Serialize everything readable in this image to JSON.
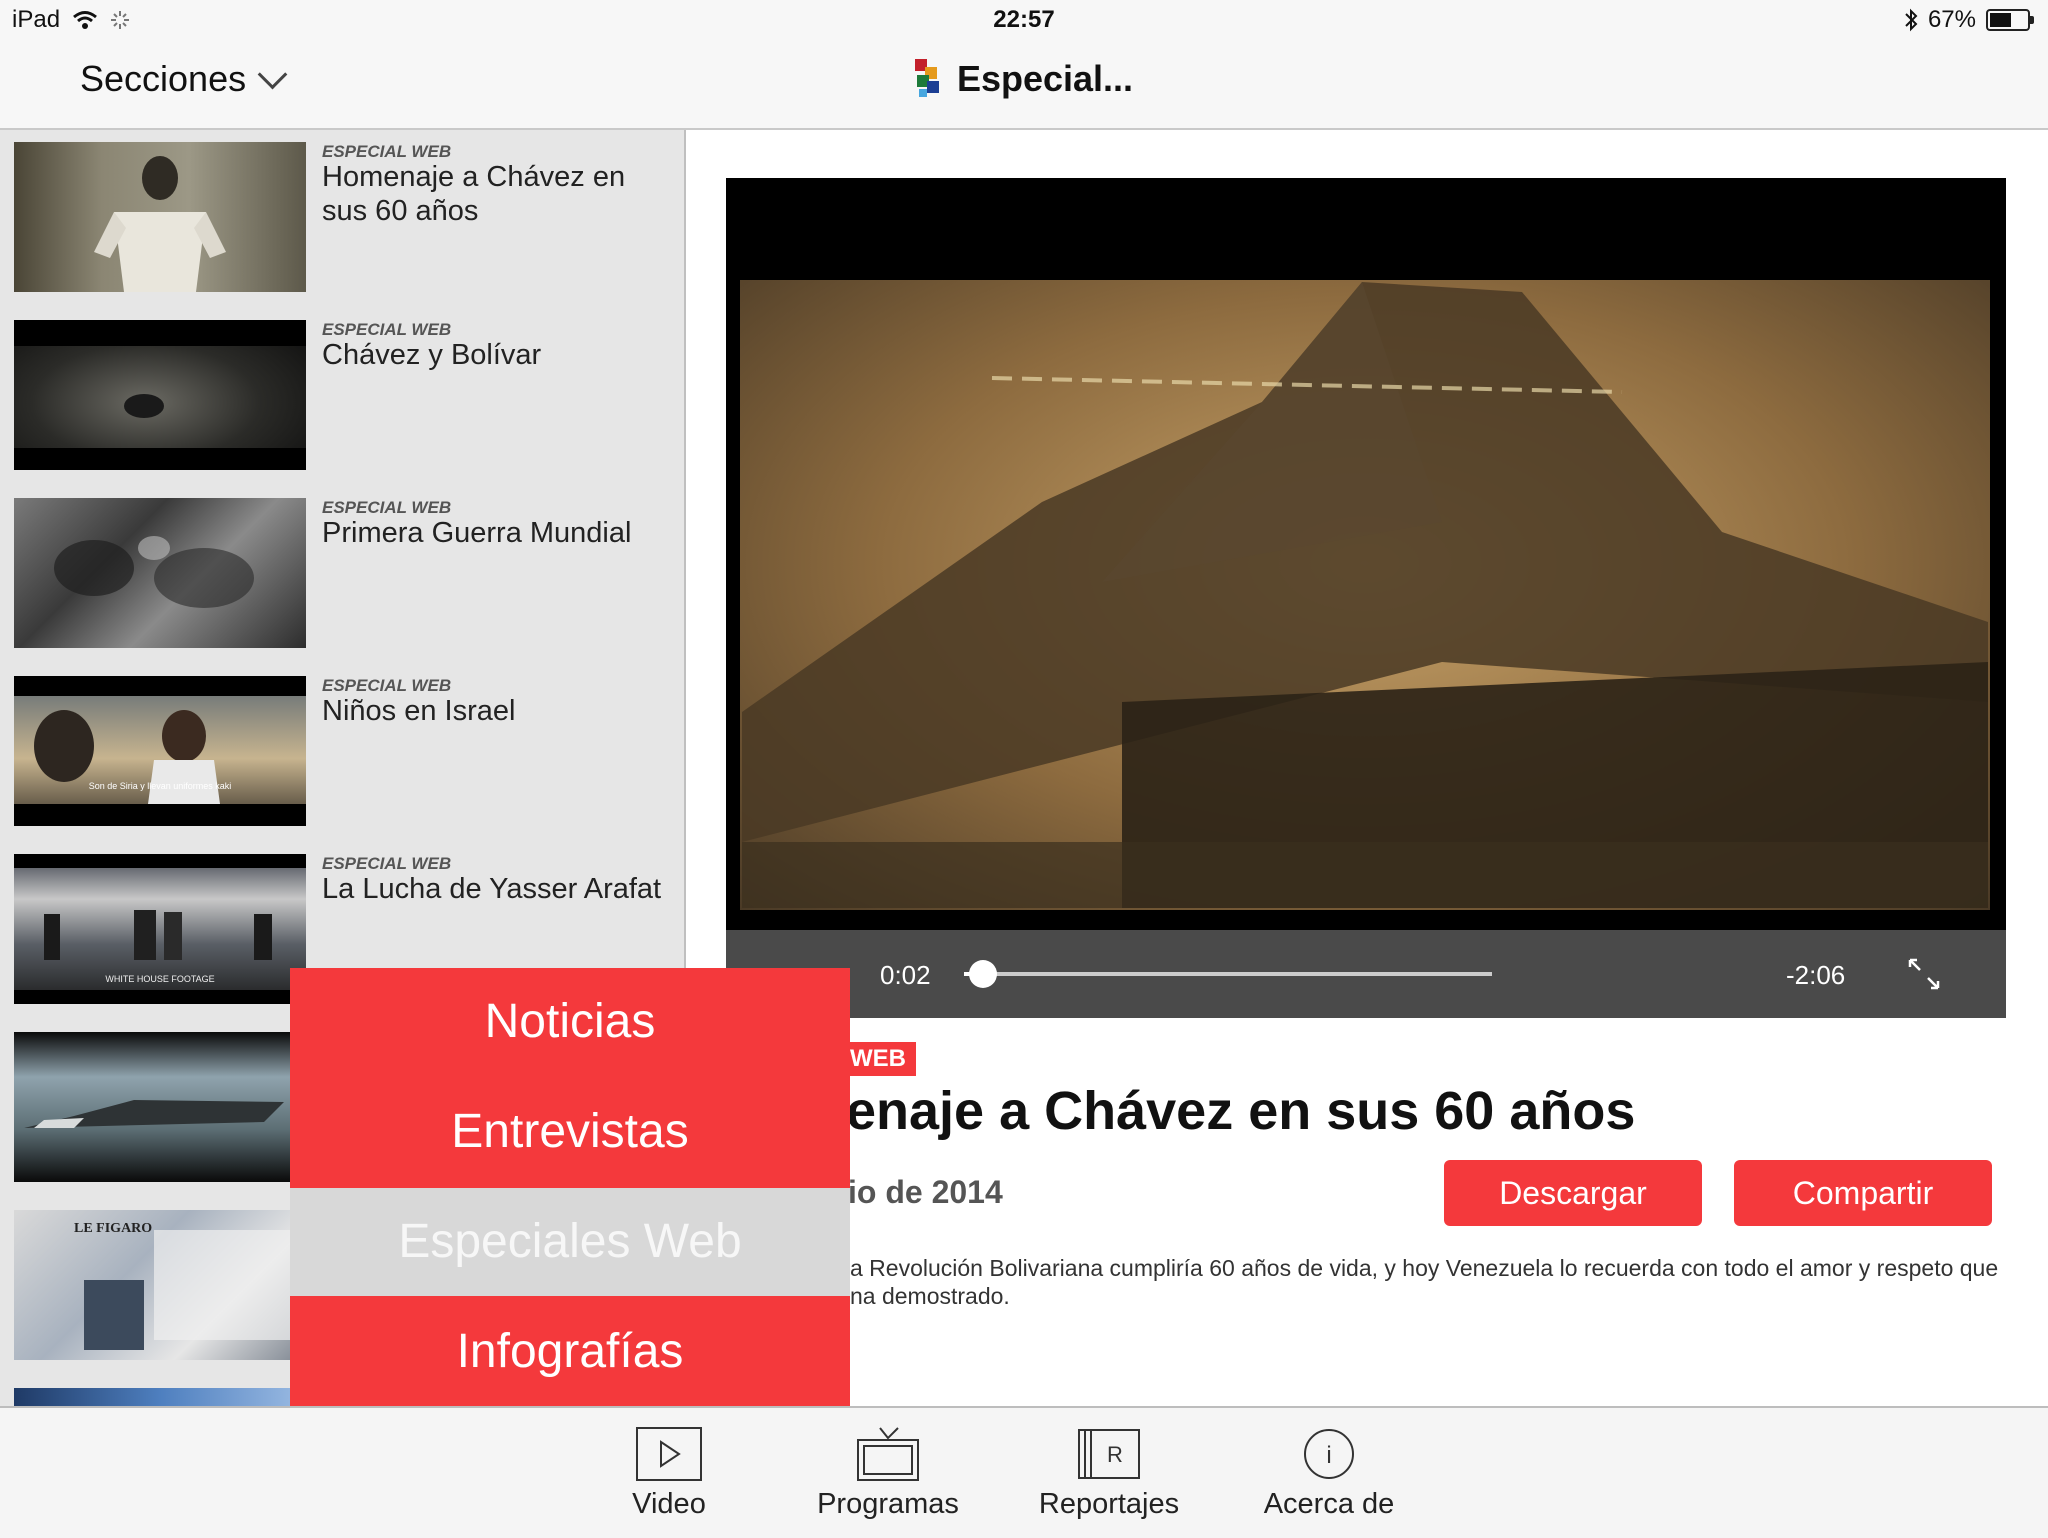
{
  "status": {
    "device": "iPad",
    "time": "22:57",
    "battery": "67%",
    "battery_level": 0.67
  },
  "nav": {
    "sections_label": "Secciones",
    "title": "Especial..."
  },
  "list": [
    {
      "category": "ESPECIAL WEB",
      "title": "Homenaje a Chávez en sus 60 años"
    },
    {
      "category": "ESPECIAL WEB",
      "title": "Chávez y Bolívar"
    },
    {
      "category": "ESPECIAL WEB",
      "title": "Primera Guerra Mundial"
    },
    {
      "category": "ESPECIAL WEB",
      "title": "Niños en Israel",
      "caption": "Son de Siria y llevan uniformes kaki"
    },
    {
      "category": "ESPECIAL WEB",
      "title": "La Lucha de Yasser Arafat",
      "caption": "WHITE HOUSE FOOTAGE"
    },
    {
      "category": "",
      "title": ""
    },
    {
      "category": "",
      "title": "",
      "caption": "LE FIGARO"
    }
  ],
  "player": {
    "elapsed": "0:02",
    "remaining": "-2:06",
    "progress": 0.02
  },
  "detail": {
    "tag": "WEB",
    "title": "enaje a Chávez en sus 60 años",
    "date": "io de 2014",
    "download": "Descargar",
    "share": "Compartir",
    "desc_line1": "a Revolución Bolivariana cumpliría 60 años de vida, y hoy Venezuela lo recuerda con todo el amor y respeto que",
    "desc_line2": "na demostrado."
  },
  "menu": {
    "items": [
      "Noticias",
      "Entrevistas",
      "Especiales Web",
      "Infografías"
    ],
    "selected": "Especiales Web"
  },
  "tabs": [
    "Video",
    "Programas",
    "Reportajes",
    "Acerca de"
  ],
  "colors": {
    "accent": "#f4393c",
    "selected_menu": "#d8d8d8"
  }
}
